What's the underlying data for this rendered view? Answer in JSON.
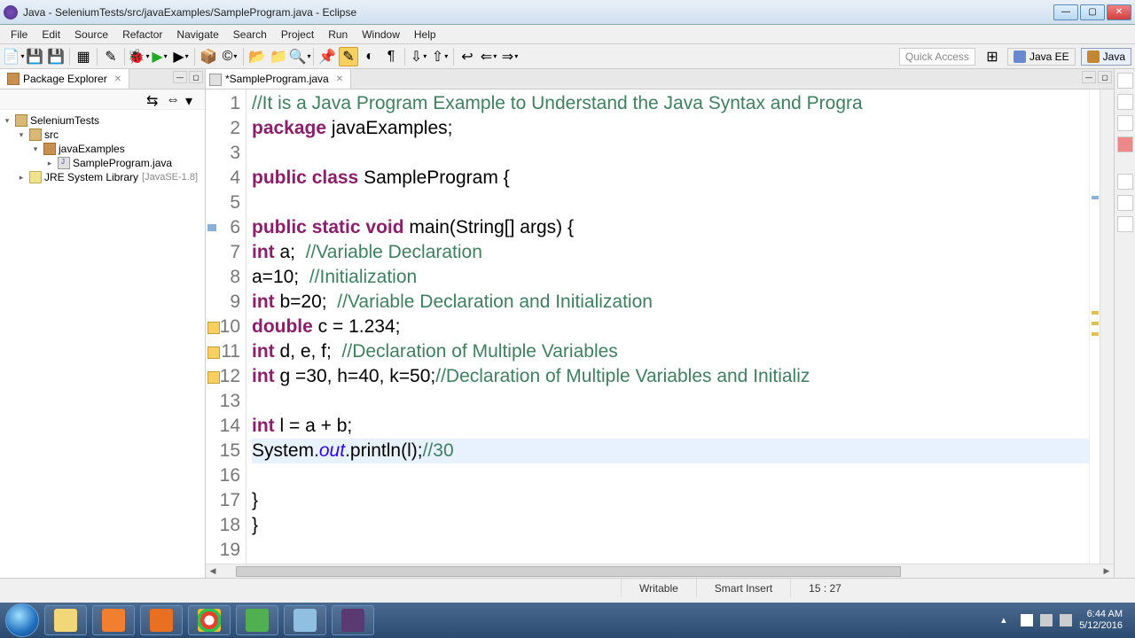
{
  "window": {
    "title": "Java - SeleniumTests/src/javaExamples/SampleProgram.java - Eclipse"
  },
  "menu": [
    "File",
    "Edit",
    "Source",
    "Refactor",
    "Navigate",
    "Search",
    "Project",
    "Run",
    "Window",
    "Help"
  ],
  "toolbar": {
    "quick_access": "Quick Access"
  },
  "perspectives": {
    "javaee": "Java EE",
    "java": "Java"
  },
  "package_explorer": {
    "title": "Package Explorer",
    "tree": {
      "project": "SeleniumTests",
      "src": "src",
      "pkg": "javaExamples",
      "file": "SampleProgram.java",
      "jre": "JRE System Library",
      "jre_ver": "[JavaSE-1.8]"
    }
  },
  "editor": {
    "tab": "*SampleProgram.java",
    "lines": [
      {
        "n": 1,
        "cm": "//It is a Java Program Example to Understand the Java Syntax and Progra"
      },
      {
        "n": 2,
        "seg": [
          [
            "kw",
            "package"
          ],
          [
            "",
            " javaExamples;"
          ]
        ]
      },
      {
        "n": 3,
        "seg": []
      },
      {
        "n": 4,
        "seg": [
          [
            "kw",
            "public"
          ],
          [
            "",
            " "
          ],
          [
            "kw",
            "class"
          ],
          [
            "",
            " SampleProgram {"
          ]
        ]
      },
      {
        "n": 5,
        "seg": []
      },
      {
        "n": 6,
        "mark": true,
        "seg": [
          [
            "kw",
            "public"
          ],
          [
            "",
            " "
          ],
          [
            "kw",
            "static"
          ],
          [
            "",
            " "
          ],
          [
            "kw",
            "void"
          ],
          [
            "",
            " main(String[] args) {"
          ]
        ]
      },
      {
        "n": 7,
        "seg": [
          [
            "kw",
            "int"
          ],
          [
            "",
            " a;  "
          ],
          [
            "cm",
            "//Variable Declaration"
          ]
        ]
      },
      {
        "n": 8,
        "seg": [
          [
            "",
            "a=10;  "
          ],
          [
            "cm",
            "//Initialization"
          ]
        ]
      },
      {
        "n": 9,
        "seg": [
          [
            "kw",
            "int"
          ],
          [
            "",
            " b=20;  "
          ],
          [
            "cm",
            "//Variable Declaration and Initialization"
          ]
        ]
      },
      {
        "n": 10,
        "warn": true,
        "seg": [
          [
            "kw",
            "double"
          ],
          [
            "",
            " c = 1.234;"
          ]
        ]
      },
      {
        "n": 11,
        "warn": true,
        "seg": [
          [
            "kw",
            "int"
          ],
          [
            "",
            " d, e, f;  "
          ],
          [
            "cm",
            "//Declaration of Multiple Variables"
          ]
        ]
      },
      {
        "n": 12,
        "warn": true,
        "seg": [
          [
            "kw",
            "int"
          ],
          [
            "",
            " g =30, h=40, k=50;"
          ],
          [
            "cm",
            "//Declaration of Multiple Variables and Initializ"
          ]
        ]
      },
      {
        "n": 13,
        "seg": []
      },
      {
        "n": 14,
        "seg": [
          [
            "kw",
            "int"
          ],
          [
            "",
            " l = a + b;"
          ]
        ]
      },
      {
        "n": 15,
        "hl": true,
        "seg": [
          [
            "",
            "System."
          ],
          [
            "st",
            "out"
          ],
          [
            "",
            ".println(l);"
          ],
          [
            "cm",
            "//30"
          ]
        ]
      },
      {
        "n": 16,
        "seg": []
      },
      {
        "n": 17,
        "seg": [
          [
            "",
            "}"
          ]
        ]
      },
      {
        "n": 18,
        "seg": [
          [
            "",
            "}"
          ]
        ]
      },
      {
        "n": 19,
        "seg": []
      }
    ]
  },
  "status": {
    "writable": "Writable",
    "insert": "Smart Insert",
    "pos": "15 : 27"
  },
  "tray": {
    "time": "6:44 AM",
    "date": "5/12/2016"
  }
}
